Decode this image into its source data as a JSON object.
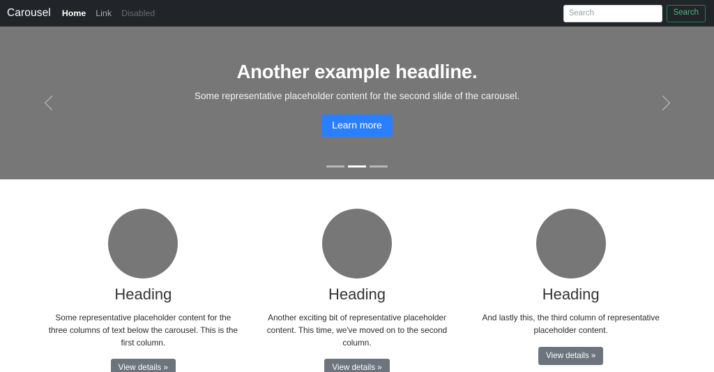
{
  "navbar": {
    "brand": "Carousel",
    "links": [
      {
        "label": "Home",
        "state": "active"
      },
      {
        "label": "Link",
        "state": "normal"
      },
      {
        "label": "Disabled",
        "state": "disabled"
      }
    ],
    "search": {
      "placeholder": "Search",
      "value": "",
      "button_label": "Search",
      "button_border_color": "#198754",
      "button_text_color": "#4bb77e"
    },
    "background_color": "#212529"
  },
  "carousel": {
    "background_color": "#777777",
    "prev_icon": "chevron-left-icon",
    "next_icon": "chevron-right-icon",
    "slide": {
      "title": "Another example headline.",
      "text": "Some representative placeholder content for the second slide of the carousel.",
      "cta_label": "Learn more",
      "cta_color": "#2a7fff"
    },
    "indicators": [
      {
        "active": false
      },
      {
        "active": true
      },
      {
        "active": false
      }
    ],
    "active_index": 1
  },
  "features": [
    {
      "image": "placeholder-circle",
      "heading": "Heading",
      "text": "Some representative placeholder content for the three columns of text below the carousel. This is the first column.",
      "button_label": "View details »"
    },
    {
      "image": "placeholder-circle",
      "heading": "Heading",
      "text": "Another exciting bit of representative placeholder content. This time, we've moved on to the second column.",
      "button_label": "View details »"
    },
    {
      "image": "placeholder-circle",
      "heading": "Heading",
      "text": "And lastly this, the third column of representative placeholder content.",
      "button_label": "View details »"
    }
  ],
  "theme": {
    "muted_gray": "#777777",
    "secondary_button": "#6c757d",
    "dark": "#212529"
  }
}
